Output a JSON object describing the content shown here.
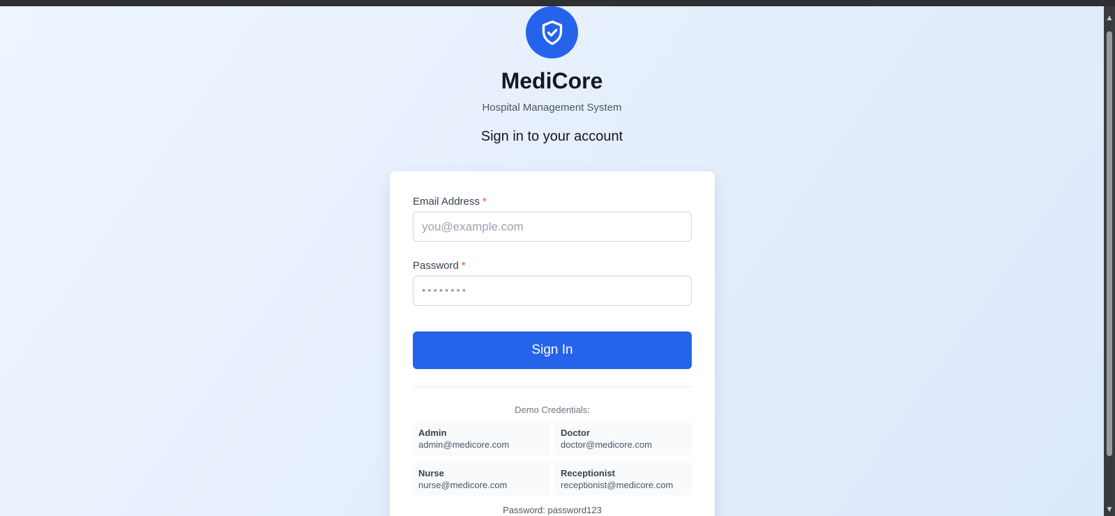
{
  "brand": {
    "name": "MediCore",
    "subtitle": "Hospital Management System",
    "primary_color": "#2563eb",
    "logo_icon": "shield-check-icon"
  },
  "signin": {
    "heading": "Sign in to your account"
  },
  "form": {
    "email_label": "Email Address",
    "email_placeholder": "you@example.com",
    "password_label": "Password",
    "password_placeholder": "••••••••",
    "required_marker": "*",
    "submit_label": "Sign In"
  },
  "demo": {
    "title": "Demo Credentials:",
    "credentials": [
      {
        "role": "Admin",
        "email": "admin@medicore.com"
      },
      {
        "role": "Doctor",
        "email": "doctor@medicore.com"
      },
      {
        "role": "Nurse",
        "email": "nurse@medicore.com"
      },
      {
        "role": "Receptionist",
        "email": "receptionist@medicore.com"
      }
    ],
    "password_note": "Password: password123"
  }
}
